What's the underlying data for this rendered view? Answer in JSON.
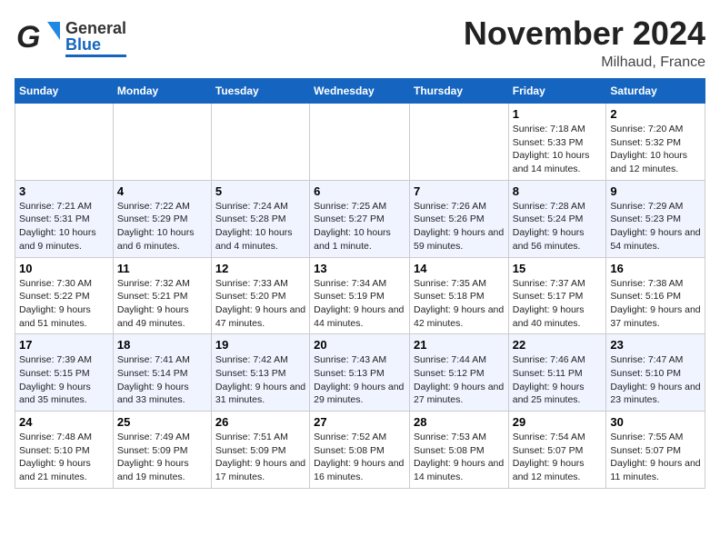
{
  "header": {
    "logo_general": "General",
    "logo_blue": "Blue",
    "title": "November 2024",
    "subtitle": "Milhaud, France"
  },
  "columns": [
    "Sunday",
    "Monday",
    "Tuesday",
    "Wednesday",
    "Thursday",
    "Friday",
    "Saturday"
  ],
  "weeks": [
    {
      "days": [
        {
          "num": "",
          "info": ""
        },
        {
          "num": "",
          "info": ""
        },
        {
          "num": "",
          "info": ""
        },
        {
          "num": "",
          "info": ""
        },
        {
          "num": "",
          "info": ""
        },
        {
          "num": "1",
          "info": "Sunrise: 7:18 AM\nSunset: 5:33 PM\nDaylight: 10 hours and 14 minutes."
        },
        {
          "num": "2",
          "info": "Sunrise: 7:20 AM\nSunset: 5:32 PM\nDaylight: 10 hours and 12 minutes."
        }
      ]
    },
    {
      "days": [
        {
          "num": "3",
          "info": "Sunrise: 7:21 AM\nSunset: 5:31 PM\nDaylight: 10 hours and 9 minutes."
        },
        {
          "num": "4",
          "info": "Sunrise: 7:22 AM\nSunset: 5:29 PM\nDaylight: 10 hours and 6 minutes."
        },
        {
          "num": "5",
          "info": "Sunrise: 7:24 AM\nSunset: 5:28 PM\nDaylight: 10 hours and 4 minutes."
        },
        {
          "num": "6",
          "info": "Sunrise: 7:25 AM\nSunset: 5:27 PM\nDaylight: 10 hours and 1 minute."
        },
        {
          "num": "7",
          "info": "Sunrise: 7:26 AM\nSunset: 5:26 PM\nDaylight: 9 hours and 59 minutes."
        },
        {
          "num": "8",
          "info": "Sunrise: 7:28 AM\nSunset: 5:24 PM\nDaylight: 9 hours and 56 minutes."
        },
        {
          "num": "9",
          "info": "Sunrise: 7:29 AM\nSunset: 5:23 PM\nDaylight: 9 hours and 54 minutes."
        }
      ]
    },
    {
      "days": [
        {
          "num": "10",
          "info": "Sunrise: 7:30 AM\nSunset: 5:22 PM\nDaylight: 9 hours and 51 minutes."
        },
        {
          "num": "11",
          "info": "Sunrise: 7:32 AM\nSunset: 5:21 PM\nDaylight: 9 hours and 49 minutes."
        },
        {
          "num": "12",
          "info": "Sunrise: 7:33 AM\nSunset: 5:20 PM\nDaylight: 9 hours and 47 minutes."
        },
        {
          "num": "13",
          "info": "Sunrise: 7:34 AM\nSunset: 5:19 PM\nDaylight: 9 hours and 44 minutes."
        },
        {
          "num": "14",
          "info": "Sunrise: 7:35 AM\nSunset: 5:18 PM\nDaylight: 9 hours and 42 minutes."
        },
        {
          "num": "15",
          "info": "Sunrise: 7:37 AM\nSunset: 5:17 PM\nDaylight: 9 hours and 40 minutes."
        },
        {
          "num": "16",
          "info": "Sunrise: 7:38 AM\nSunset: 5:16 PM\nDaylight: 9 hours and 37 minutes."
        }
      ]
    },
    {
      "days": [
        {
          "num": "17",
          "info": "Sunrise: 7:39 AM\nSunset: 5:15 PM\nDaylight: 9 hours and 35 minutes."
        },
        {
          "num": "18",
          "info": "Sunrise: 7:41 AM\nSunset: 5:14 PM\nDaylight: 9 hours and 33 minutes."
        },
        {
          "num": "19",
          "info": "Sunrise: 7:42 AM\nSunset: 5:13 PM\nDaylight: 9 hours and 31 minutes."
        },
        {
          "num": "20",
          "info": "Sunrise: 7:43 AM\nSunset: 5:13 PM\nDaylight: 9 hours and 29 minutes."
        },
        {
          "num": "21",
          "info": "Sunrise: 7:44 AM\nSunset: 5:12 PM\nDaylight: 9 hours and 27 minutes."
        },
        {
          "num": "22",
          "info": "Sunrise: 7:46 AM\nSunset: 5:11 PM\nDaylight: 9 hours and 25 minutes."
        },
        {
          "num": "23",
          "info": "Sunrise: 7:47 AM\nSunset: 5:10 PM\nDaylight: 9 hours and 23 minutes."
        }
      ]
    },
    {
      "days": [
        {
          "num": "24",
          "info": "Sunrise: 7:48 AM\nSunset: 5:10 PM\nDaylight: 9 hours and 21 minutes."
        },
        {
          "num": "25",
          "info": "Sunrise: 7:49 AM\nSunset: 5:09 PM\nDaylight: 9 hours and 19 minutes."
        },
        {
          "num": "26",
          "info": "Sunrise: 7:51 AM\nSunset: 5:09 PM\nDaylight: 9 hours and 17 minutes."
        },
        {
          "num": "27",
          "info": "Sunrise: 7:52 AM\nSunset: 5:08 PM\nDaylight: 9 hours and 16 minutes."
        },
        {
          "num": "28",
          "info": "Sunrise: 7:53 AM\nSunset: 5:08 PM\nDaylight: 9 hours and 14 minutes."
        },
        {
          "num": "29",
          "info": "Sunrise: 7:54 AM\nSunset: 5:07 PM\nDaylight: 9 hours and 12 minutes."
        },
        {
          "num": "30",
          "info": "Sunrise: 7:55 AM\nSunset: 5:07 PM\nDaylight: 9 hours and 11 minutes."
        }
      ]
    }
  ]
}
